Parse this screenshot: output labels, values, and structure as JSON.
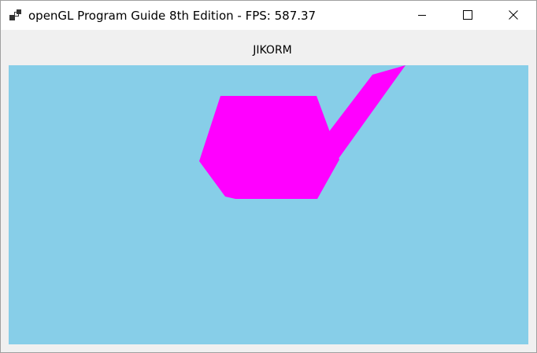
{
  "window": {
    "title": "openGL Program Guide 8th Edition - FPS: 587.37",
    "icon": "app-window-icon",
    "controls": {
      "minimize_icon": "minimize-icon",
      "maximize_icon": "maximize-icon",
      "close_icon": "close-icon"
    }
  },
  "label": {
    "text": "JIKORM"
  },
  "viewport": {
    "background_color": "#87CEE8",
    "shape_color": "#FF00FF",
    "shape": "teapot-silhouette"
  }
}
